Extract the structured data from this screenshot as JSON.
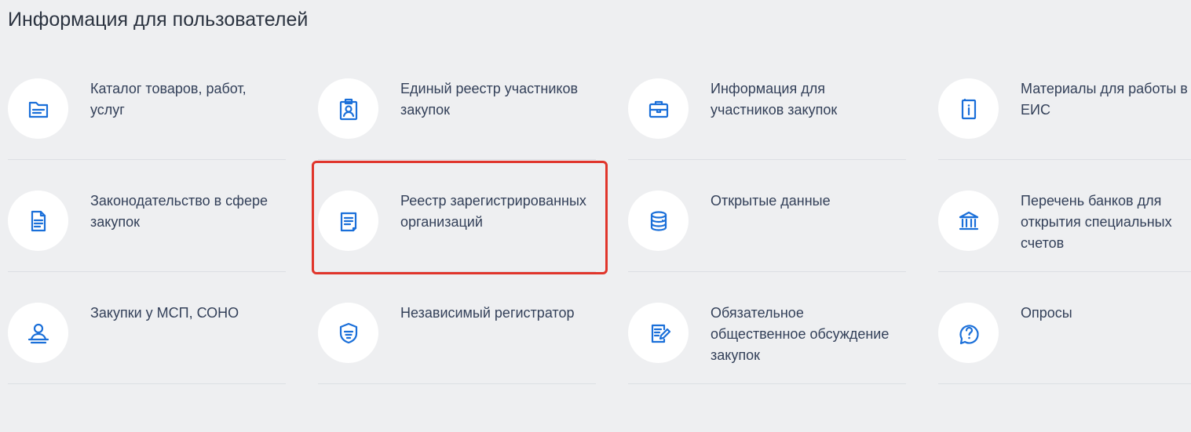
{
  "page": {
    "title": "Информация для пользователей"
  },
  "tiles": [
    {
      "label": "Каталог товаров, работ, услуг",
      "icon": "folder-icon"
    },
    {
      "label": "Единый реестр участников закупок",
      "icon": "id-badge-icon"
    },
    {
      "label": "Информация для участников закупок",
      "icon": "briefcase-icon"
    },
    {
      "label": "Материалы для работы в ЕИС",
      "icon": "info-book-icon"
    },
    {
      "label": "Законодательство в сфере закупок",
      "icon": "document-icon"
    },
    {
      "label": "Реестр зарегистрированных организаций",
      "icon": "register-document-icon"
    },
    {
      "label": "Открытые данные",
      "icon": "database-icon"
    },
    {
      "label": "Перечень банков для открытия специальных счетов",
      "icon": "bank-icon"
    },
    {
      "label": "Закупки у МСП, СОНО",
      "icon": "user-on-stand-icon"
    },
    {
      "label": "Независимый регистратор",
      "icon": "shield-icon"
    },
    {
      "label": "Обязательное общественное обсуждение закупок",
      "icon": "edit-document-icon"
    },
    {
      "label": "Опросы",
      "icon": "question-circle-icon"
    }
  ],
  "colors": {
    "accent": "#1a6fd9",
    "background": "#eeeff1",
    "highlight_border": "#e0352b"
  }
}
